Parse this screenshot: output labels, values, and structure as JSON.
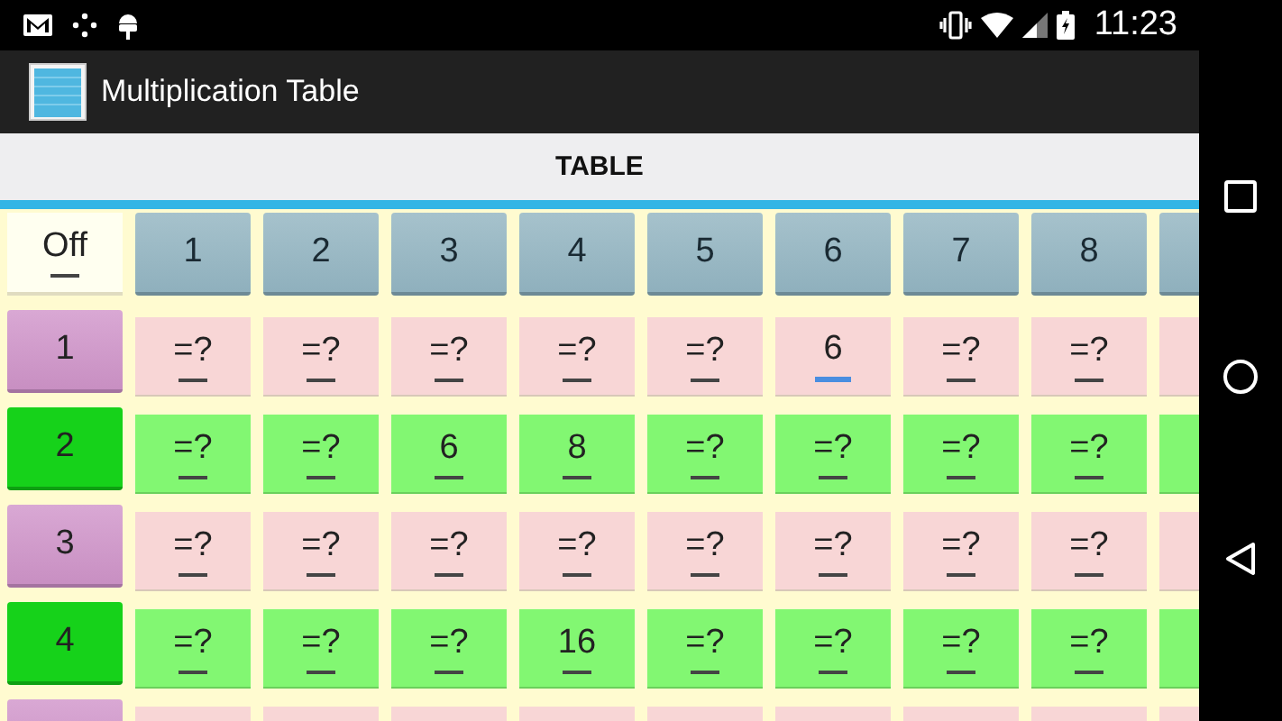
{
  "status_bar": {
    "time": "11:23"
  },
  "app_bar": {
    "title": "Multiplication Table"
  },
  "tab": {
    "label": "TABLE"
  },
  "corner": {
    "label": "Off"
  },
  "columns": [
    "1",
    "2",
    "3",
    "4",
    "5",
    "6",
    "7",
    "8"
  ],
  "rows": [
    {
      "label": "1",
      "kind": "pink",
      "cells": [
        {
          "value": "=?",
          "focused": false
        },
        {
          "value": "=?",
          "focused": false
        },
        {
          "value": "=?",
          "focused": false
        },
        {
          "value": "=?",
          "focused": false
        },
        {
          "value": "=?",
          "focused": false
        },
        {
          "value": "6",
          "focused": true
        },
        {
          "value": "=?",
          "focused": false
        },
        {
          "value": "=?",
          "focused": false
        }
      ]
    },
    {
      "label": "2",
      "kind": "green",
      "cells": [
        {
          "value": "=?",
          "focused": false
        },
        {
          "value": "=?",
          "focused": false
        },
        {
          "value": "6",
          "focused": false
        },
        {
          "value": "8",
          "focused": false
        },
        {
          "value": "=?",
          "focused": false
        },
        {
          "value": "=?",
          "focused": false
        },
        {
          "value": "=?",
          "focused": false
        },
        {
          "value": "=?",
          "focused": false
        }
      ]
    },
    {
      "label": "3",
      "kind": "pink",
      "cells": [
        {
          "value": "=?",
          "focused": false
        },
        {
          "value": "=?",
          "focused": false
        },
        {
          "value": "=?",
          "focused": false
        },
        {
          "value": "=?",
          "focused": false
        },
        {
          "value": "=?",
          "focused": false
        },
        {
          "value": "=?",
          "focused": false
        },
        {
          "value": "=?",
          "focused": false
        },
        {
          "value": "=?",
          "focused": false
        }
      ]
    },
    {
      "label": "4",
      "kind": "green",
      "cells": [
        {
          "value": "=?",
          "focused": false
        },
        {
          "value": "=?",
          "focused": false
        },
        {
          "value": "=?",
          "focused": false
        },
        {
          "value": "16",
          "focused": false
        },
        {
          "value": "=?",
          "focused": false
        },
        {
          "value": "=?",
          "focused": false
        },
        {
          "value": "=?",
          "focused": false
        },
        {
          "value": "=?",
          "focused": false
        }
      ]
    }
  ]
}
